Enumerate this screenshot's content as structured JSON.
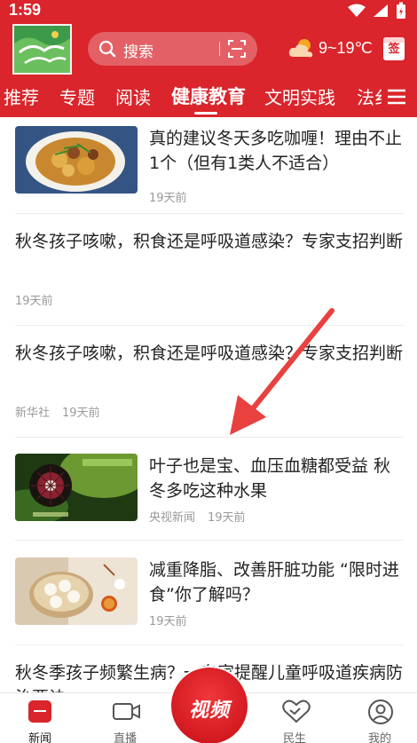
{
  "status_bar": {
    "time": "1:59"
  },
  "header": {
    "search_placeholder": "搜索",
    "weather": "9~19℃",
    "checkin_label": "签",
    "tabs": [
      {
        "label": "推荐",
        "active": false
      },
      {
        "label": "专题",
        "active": false
      },
      {
        "label": "阅读",
        "active": false
      },
      {
        "label": "健康教育",
        "active": true
      },
      {
        "label": "文明实践",
        "active": false
      },
      {
        "label": "法纟",
        "active": false
      }
    ]
  },
  "feed": {
    "items": [
      {
        "title": "真的建议冬天多吃咖喱！理由不止1个（但有1类人不适合）",
        "source": "",
        "time": "19天前",
        "thumb": "curry"
      },
      {
        "title": "秋冬孩子咳嗽，积食还是呼吸道感染？专家支招判断",
        "source": "",
        "time": "19天前",
        "thumb": ""
      },
      {
        "title": "秋冬孩子咳嗽，积食还是呼吸道感染？专家支招判断",
        "source": "新华社",
        "time": "19天前",
        "thumb": ""
      },
      {
        "title": "叶子也是宝、血压血糖都受益 秋冬多吃这种水果",
        "source": "央视新闻",
        "time": "19天前",
        "thumb": "fruit"
      },
      {
        "title": "减重降脂、改善肝脏功能 “限时进食”你了解吗？",
        "source": "",
        "time": "19天前",
        "thumb": "dumplings"
      },
      {
        "title": "秋冬季孩子频繁生病？一专家提醒儿童呼吸道疾病防治要诀",
        "source": "",
        "time": "",
        "thumb": ""
      }
    ]
  },
  "bottom_nav": {
    "items": [
      {
        "label": "新闻",
        "icon": "news-icon",
        "active": true
      },
      {
        "label": "直播",
        "icon": "live-camera-icon",
        "active": false
      },
      {
        "label": "民生",
        "icon": "handshake-heart-icon",
        "active": false
      },
      {
        "label": "我的",
        "icon": "profile-icon",
        "active": false
      }
    ],
    "video_label": "视频"
  },
  "colors": {
    "brand_red": "#d9252b",
    "arrow_red": "#e8413f"
  }
}
